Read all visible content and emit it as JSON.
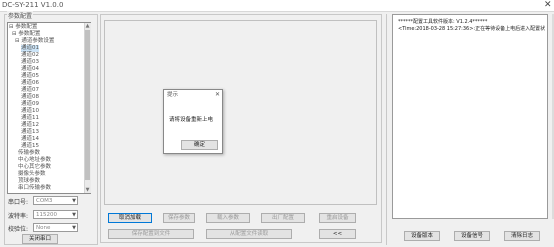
{
  "window": {
    "title": "DC-SY-211 V1.0.0",
    "close_glyph": "✕"
  },
  "left": {
    "group_label": "参数配置",
    "tree": [
      {
        "text": "⊟ 参数配置",
        "indent": 0
      },
      {
        "text": "⊟ 参数配置",
        "indent": 1
      },
      {
        "text": "⊟ 通道参数设置",
        "indent": 2
      },
      {
        "text": "通道01",
        "indent": 4,
        "selected": true
      },
      {
        "text": "通道02",
        "indent": 4
      },
      {
        "text": "通道03",
        "indent": 4
      },
      {
        "text": "通道04",
        "indent": 4
      },
      {
        "text": "通道05",
        "indent": 4
      },
      {
        "text": "通道06",
        "indent": 4
      },
      {
        "text": "通道07",
        "indent": 4
      },
      {
        "text": "通道08",
        "indent": 4
      },
      {
        "text": "通道09",
        "indent": 4
      },
      {
        "text": "通道10",
        "indent": 4
      },
      {
        "text": "通道11",
        "indent": 4
      },
      {
        "text": "通道12",
        "indent": 4
      },
      {
        "text": "通道13",
        "indent": 4
      },
      {
        "text": "通道14",
        "indent": 4
      },
      {
        "text": "通道15",
        "indent": 4
      },
      {
        "text": "传输参数",
        "indent": 3
      },
      {
        "text": "中心地址参数",
        "indent": 3
      },
      {
        "text": "中心其它参数",
        "indent": 3
      },
      {
        "text": "摄像头参数",
        "indent": 3
      },
      {
        "text": "顶球参数",
        "indent": 3
      },
      {
        "text": "串口传输参数",
        "indent": 3
      }
    ],
    "port_label": "串口号:",
    "port_value": "COM3",
    "baud_label": "波特率:",
    "baud_value": "115200",
    "parity_label": "校验位:",
    "parity_value": "None",
    "close_port": "关闭串口"
  },
  "middle": {
    "buttons_row1": [
      "取消加载",
      "保存参数",
      "载入参数",
      "出厂配置",
      "重启设备"
    ],
    "buttons_row2": [
      "保存配置到文件",
      "从配置文件读取",
      "<<"
    ]
  },
  "dialog": {
    "title": "提示",
    "close_glyph": "✕",
    "message": "请将设备重新上电",
    "ok": "确定"
  },
  "log": {
    "lines": [
      "******配置工具软件版本: V1.2.4******",
      "<Time:2018-03-28 15:27:36>:正在等待设备上电后进入配置状"
    ]
  },
  "right_buttons": [
    "设备版本",
    "设备信号",
    "清除日志"
  ]
}
